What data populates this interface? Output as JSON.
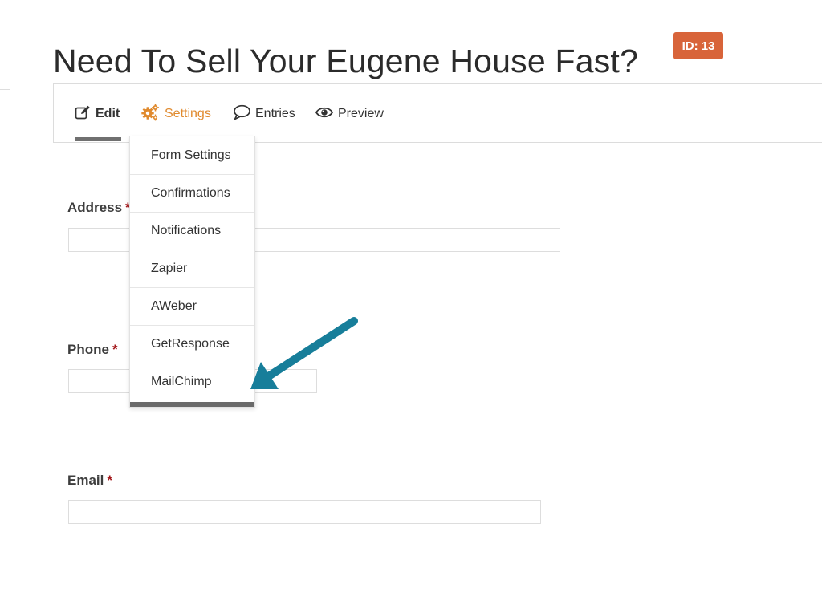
{
  "page": {
    "title": "Need To Sell Your Eugene House Fast?",
    "id_badge": "ID: 13",
    "badge_color": "#d8643a"
  },
  "toolbar": {
    "tabs": [
      {
        "label": "Edit",
        "icon": "edit-icon",
        "active": true
      },
      {
        "label": "Settings",
        "icon": "gears-icon",
        "color": "#e08a2e"
      },
      {
        "label": "Entries",
        "icon": "speech-bubble-icon"
      },
      {
        "label": "Preview",
        "icon": "eye-icon"
      }
    ]
  },
  "settings_menu": {
    "items": [
      {
        "label": "Form Settings"
      },
      {
        "label": "Confirmations"
      },
      {
        "label": "Notifications"
      },
      {
        "label": "Zapier"
      },
      {
        "label": "AWeber"
      },
      {
        "label": "GetResponse"
      },
      {
        "label": "MailChimp"
      }
    ]
  },
  "form": {
    "fields": [
      {
        "label": "Address",
        "required_marker": "*",
        "value": ""
      },
      {
        "label": "Phone",
        "required_marker": "*",
        "value": ""
      },
      {
        "label": "Email",
        "required_marker": "*",
        "value": ""
      }
    ]
  },
  "annotation": {
    "arrow_color": "#177e9a",
    "points_to": "MailChimp"
  }
}
